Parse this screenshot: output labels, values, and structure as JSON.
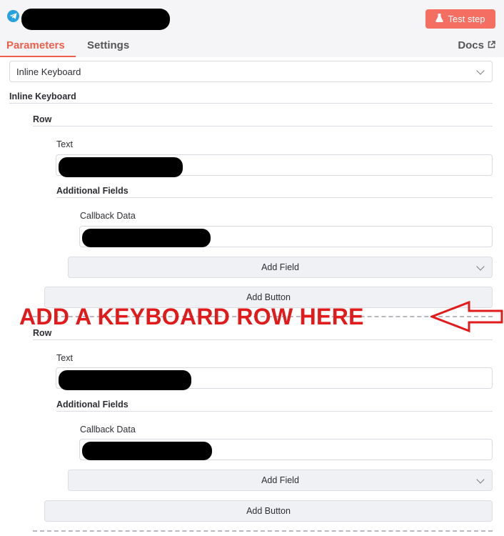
{
  "header": {
    "icon": "telegram-icon",
    "test_step_label": "Test step",
    "test_step_icon": "flask-icon"
  },
  "tabs": [
    {
      "label": "Parameters",
      "active": true
    },
    {
      "label": "Settings",
      "active": false
    }
  ],
  "docs_label": "Docs",
  "reply_markup_select": {
    "value": "Inline Keyboard"
  },
  "section_title": "Inline Keyboard",
  "rows": [
    {
      "row_label": "Row",
      "text_label": "Text",
      "additional_fields_label": "Additional Fields",
      "callback_label": "Callback Data",
      "add_field_label": "Add Field",
      "add_button_label": "Add Button"
    },
    {
      "row_label": "Row",
      "text_label": "Text",
      "additional_fields_label": "Additional Fields",
      "callback_label": "Callback Data",
      "add_field_label": "Add Field",
      "add_button_label": "Add Button"
    }
  ],
  "annotation": {
    "text": "ADD A KEYBOARD ROW HERE",
    "color": "#e11b1b"
  },
  "colors": {
    "accent": "#ec5f4d",
    "test_button": "#f56e62",
    "telegram": "#27a2de"
  }
}
